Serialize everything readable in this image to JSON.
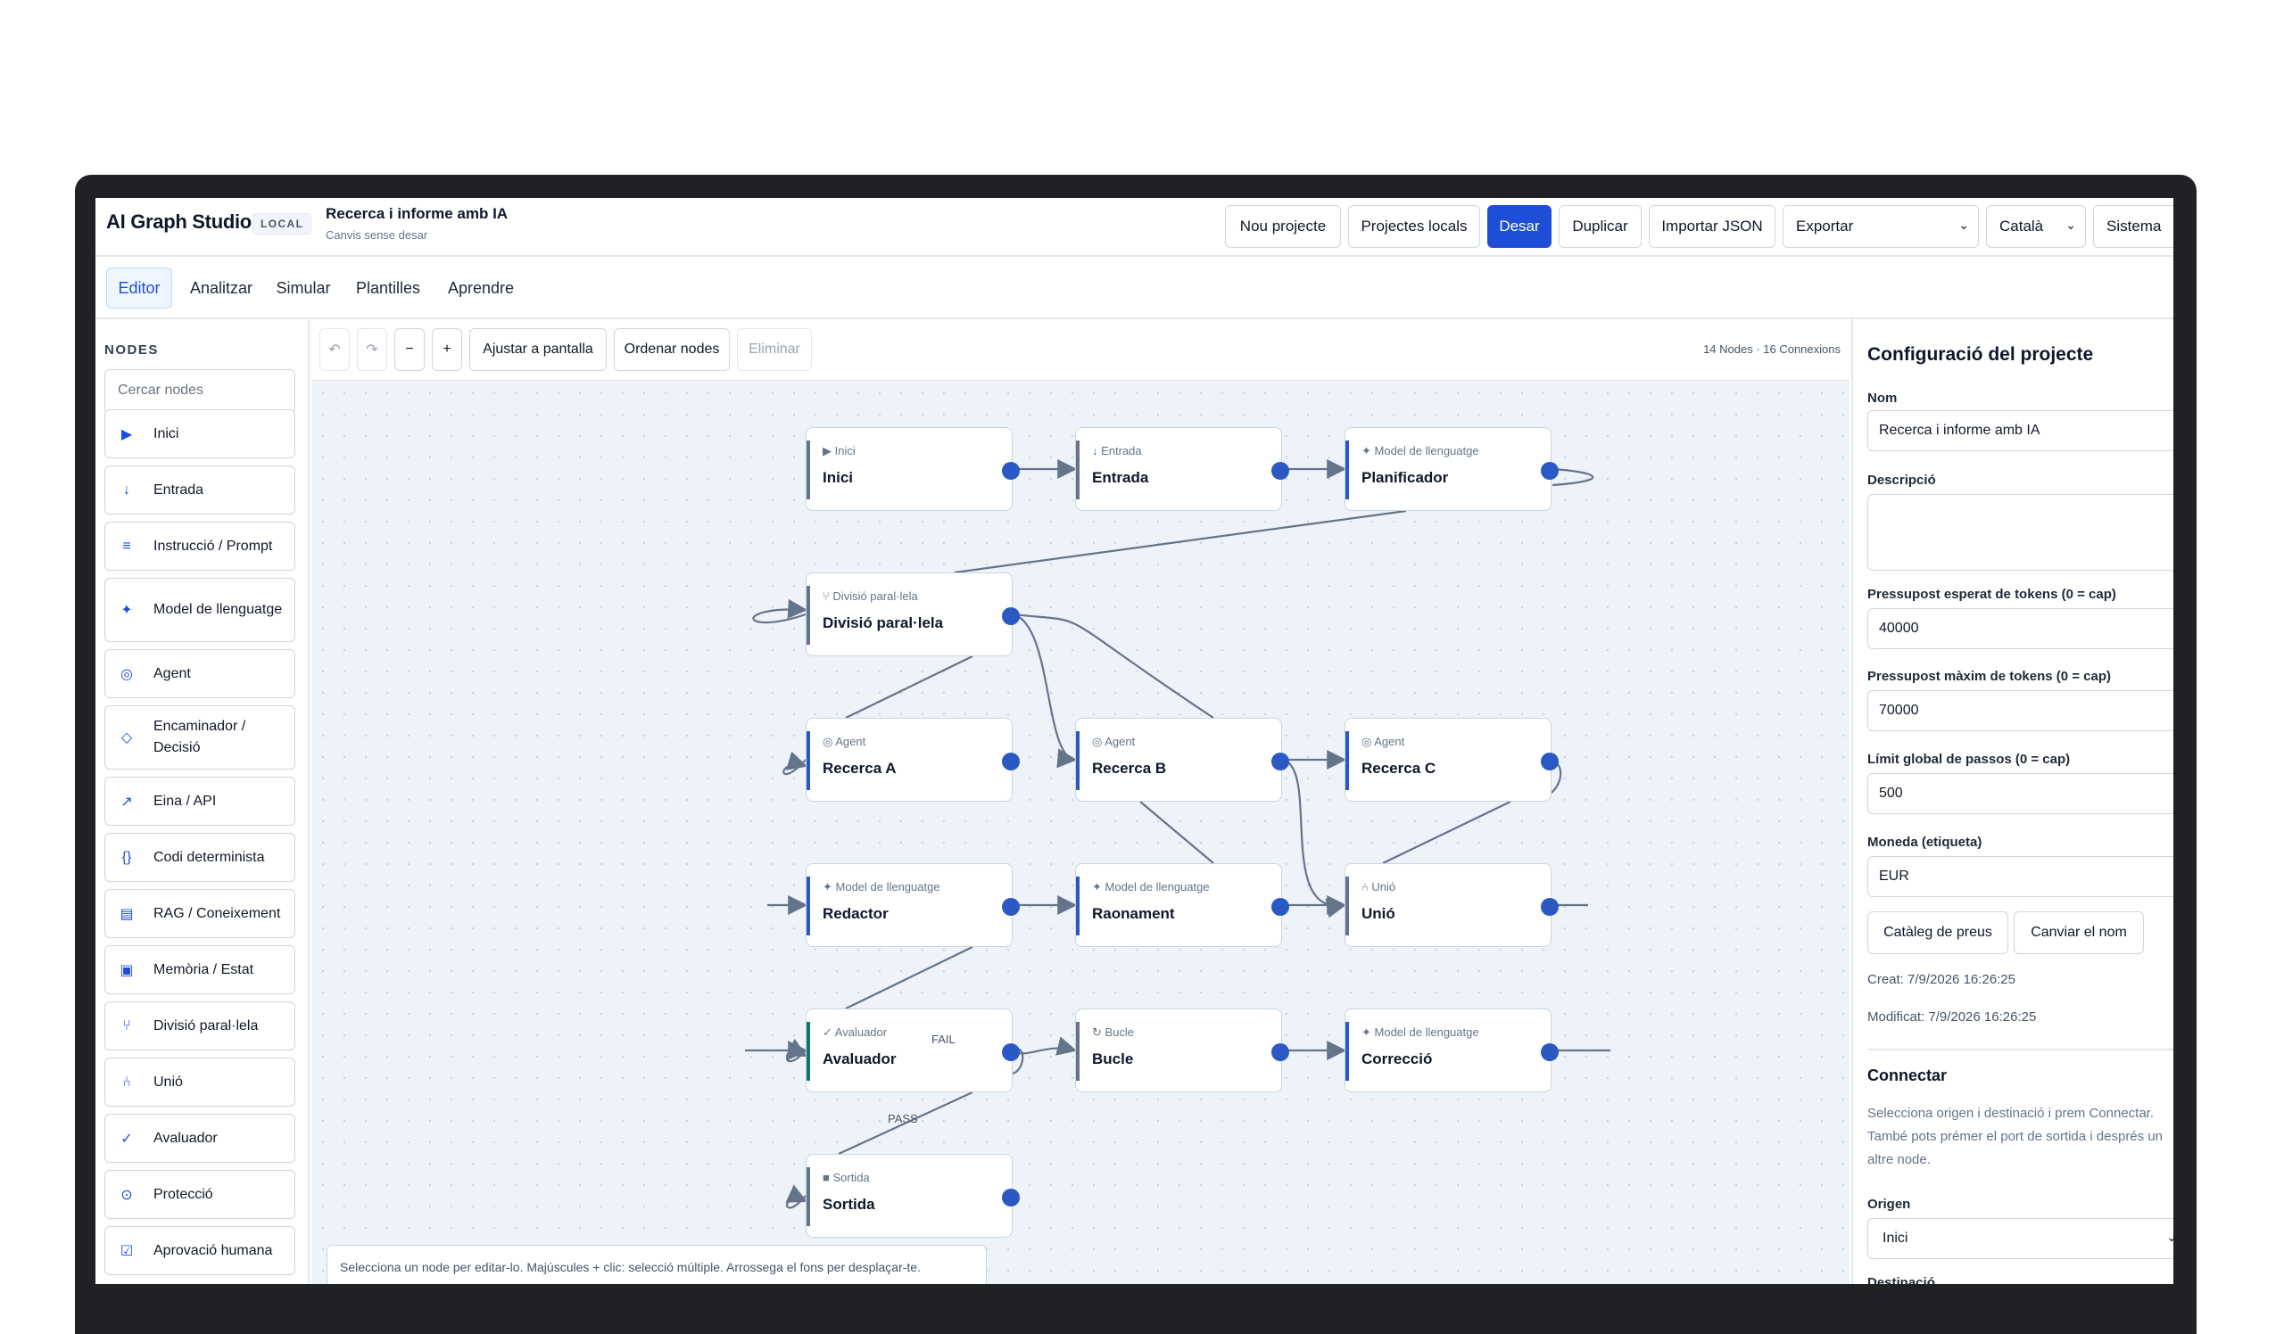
{
  "header": {
    "brand": "AI Graph Studio",
    "badge": "LOCAL",
    "project_title": "Recerca i informe amb IA",
    "project_subtitle": "Canvis sense desar",
    "buttons": {
      "new_project": "Nou projecte",
      "local_projects": "Projectes locals",
      "save": "Desar",
      "duplicate": "Duplicar",
      "import_json": "Importar JSON"
    },
    "export_select": "Exportar",
    "language_select": "Català",
    "theme_select": "Sistema"
  },
  "tabs": [
    "Editor",
    "Analitzar",
    "Simular",
    "Plantilles",
    "Aprendre"
  ],
  "sidebar": {
    "title": "NODES",
    "search_placeholder": "Cercar nodes",
    "items": [
      {
        "label": "Inici",
        "icon": "▶"
      },
      {
        "label": "Entrada",
        "icon": "↓"
      },
      {
        "label": "Instrucció / Prompt",
        "icon": "≡"
      },
      {
        "label": "Model de llenguatge",
        "icon": "✦"
      },
      {
        "label": "Agent",
        "icon": "◎"
      },
      {
        "label": "Encaminador / Decisió",
        "icon": "◇"
      },
      {
        "label": "Eina / API",
        "icon": "↗"
      },
      {
        "label": "Codi determinista",
        "icon": "{}"
      },
      {
        "label": "RAG / Coneixement",
        "icon": "▤"
      },
      {
        "label": "Memòria / Estat",
        "icon": "▣"
      },
      {
        "label": "Divisió paral·lela",
        "icon": "⑂"
      },
      {
        "label": "Unió",
        "icon": "⑃"
      },
      {
        "label": "Avaluador",
        "icon": "✓"
      },
      {
        "label": "Protecció",
        "icon": "⊙"
      },
      {
        "label": "Aprovació humana",
        "icon": "☑"
      }
    ]
  },
  "toolbar": {
    "undo": "↶",
    "redo": "↷",
    "zoom_out": "−",
    "zoom_in": "+",
    "fit": "Ajustar a pantalla",
    "arrange": "Ordenar nodes",
    "delete": "Eliminar",
    "counts": "14 Nodes · 16 Connexions"
  },
  "canvas": {
    "nodes": [
      {
        "id": "inici",
        "type": "▶ Inici",
        "name": "Inici"
      },
      {
        "id": "entrada",
        "type": "↓ Entrada",
        "name": "Entrada"
      },
      {
        "id": "planificador",
        "type": "✦ Model de llenguatge",
        "name": "Planificador"
      },
      {
        "id": "divisio",
        "type": "⑂ Divisió paral·lela",
        "name": "Divisió paral·lela"
      },
      {
        "id": "recerca_a",
        "type": "◎ Agent",
        "name": "Recerca A"
      },
      {
        "id": "recerca_b",
        "type": "◎ Agent",
        "name": "Recerca B"
      },
      {
        "id": "recerca_c",
        "type": "◎ Agent",
        "name": "Recerca C"
      },
      {
        "id": "redactor",
        "type": "✦ Model de llenguatge",
        "name": "Redactor"
      },
      {
        "id": "raonament",
        "type": "✦ Model de llenguatge",
        "name": "Raonament"
      },
      {
        "id": "unio",
        "type": "⑃ Unió",
        "name": "Unió"
      },
      {
        "id": "avaluador",
        "type": "✓ Avaluador",
        "name": "Avaluador"
      },
      {
        "id": "bucle",
        "type": "↻ Bucle",
        "name": "Bucle"
      },
      {
        "id": "correccio",
        "type": "✦ Model de llenguatge",
        "name": "Correcció"
      },
      {
        "id": "sortida",
        "type": "■ Sortida",
        "name": "Sortida"
      }
    ],
    "edge_labels": {
      "fail": "FAIL",
      "pass": "PASS"
    },
    "hint": "Selecciona un node per editar-lo. Majúscules + clic: selecció múltiple. Arrossega el fons per desplaçar-te."
  },
  "panel": {
    "title": "Configuració del projecte",
    "name_label": "Nom",
    "name_value": "Recerca i informe amb IA",
    "description_label": "Descripció",
    "description_value": "",
    "budget_expected_label": "Pressupost esperat de tokens (0 = cap)",
    "budget_expected_value": "40000",
    "budget_max_label": "Pressupost màxim de tokens (0 = cap)",
    "budget_max_value": "70000",
    "steps_label": "Límit global de passos (0 = cap)",
    "steps_value": "500",
    "currency_label": "Moneda (etiqueta)",
    "currency_value": "EUR",
    "pricing_button": "Catàleg de preus",
    "rename_button": "Canviar el nom",
    "created": "Creat: 7/9/2026 16:26:25",
    "modified": "Modificat: 7/9/2026 16:26:25",
    "connect_title": "Connectar",
    "connect_help": "Selecciona origen i destinació i prem Connectar. També pots prémer el port de sortida i després un altre node.",
    "origin_label": "Origen",
    "origin_value": "Inici",
    "destination_label": "Destinació"
  }
}
